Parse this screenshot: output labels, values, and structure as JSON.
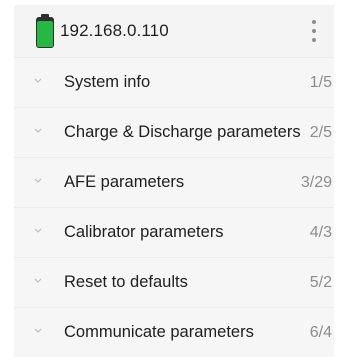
{
  "header": {
    "host": "192.168.0.110",
    "battery_level": 0.9,
    "battery_color": "#27b843",
    "menu_icon": "more-vertical-icon"
  },
  "sections": [
    {
      "label": "System info",
      "count": "1/5"
    },
    {
      "label": "Charge & Discharge parameters",
      "count": "2/5"
    },
    {
      "label": "AFE parameters",
      "count": "3/29"
    },
    {
      "label": "Calibrator parameters",
      "count": "4/3"
    },
    {
      "label": "Reset to defaults",
      "count": "5/2"
    },
    {
      "label": "Communicate parameters",
      "count": "6/4"
    }
  ],
  "section_icon": "chevron-down-icon"
}
